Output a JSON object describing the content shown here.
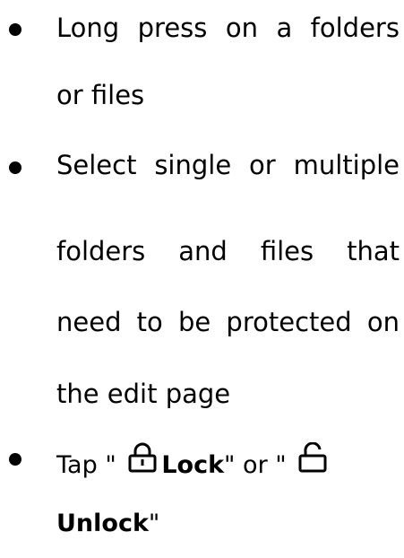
{
  "bullets": [
    {
      "lines": [
        [
          "Long",
          "press",
          "on",
          "a",
          "folders"
        ],
        [
          "or files"
        ]
      ]
    },
    {
      "lines": [
        [
          "Select",
          "single",
          "or",
          "multiple"
        ],
        [
          "folders",
          "and",
          "files",
          "that"
        ],
        [
          "need",
          "to",
          "be",
          "protected",
          "on"
        ],
        [
          "the edit page"
        ]
      ]
    },
    {
      "tap": "Tap",
      "quote_open": "\"",
      "lock_label": "Lock",
      "quote_close_or": "\" or \"",
      "unlock_label": "Unlock",
      "quote_close": "\"",
      "lock_icon": "lock-closed-icon",
      "unlock_icon": "lock-open-icon"
    }
  ]
}
